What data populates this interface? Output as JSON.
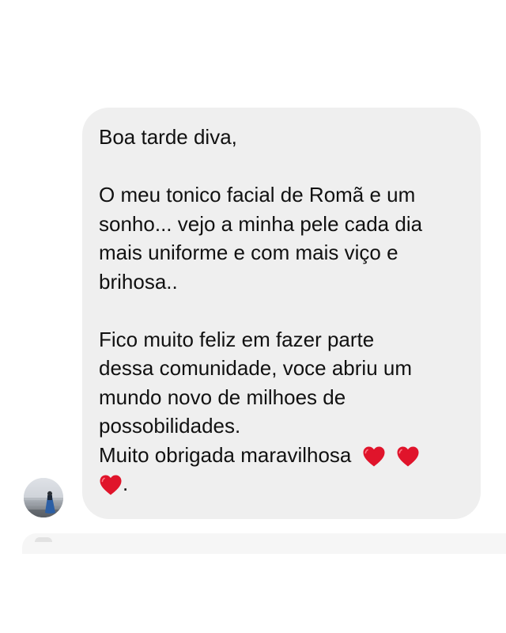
{
  "message": {
    "paragraphs": [
      {
        "lines": [
          "Boa tarde diva,"
        ]
      },
      {
        "lines": [
          "O meu tonico facial de Romã e um",
          "sonho... vejo a minha pele cada dia",
          "mais uniforme e com mais viço e",
          "brihosa.."
        ]
      },
      {
        "lines": [
          "Fico muito feliz em fazer parte",
          "dessa comunidade, voce abriu um",
          "mundo novo de milhoes de",
          "possobilidades."
        ]
      }
    ],
    "closing": "Muito obrigada maravilhosa",
    "closing_end": ".",
    "hearts": 3,
    "heart_icon": "red-heart-emoji-icon",
    "heart_color": "#e0142b",
    "bubble_color": "#efefef"
  },
  "sender": {
    "avatar_icon": "beach-profile-photo"
  }
}
